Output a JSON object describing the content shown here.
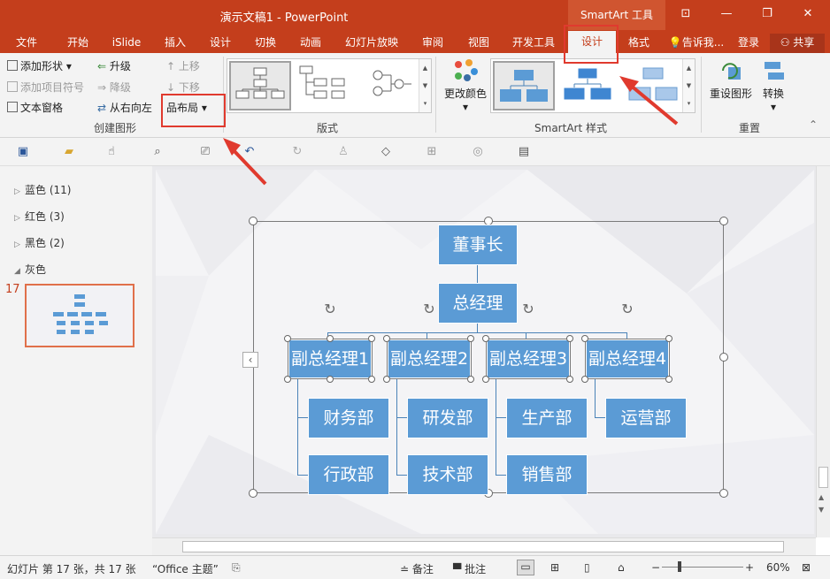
{
  "window": {
    "title": "演示文稿1 - PowerPoint",
    "context_tab": "SmartArt 工具",
    "buttons": [
      "ribbon-display",
      "minimize",
      "restore",
      "close"
    ]
  },
  "tabs": [
    "文件",
    "开始",
    "iSlide",
    "插入",
    "设计",
    "切换",
    "动画",
    "幻灯片放映",
    "审阅",
    "视图",
    "开发工具",
    "设计",
    "格式"
  ],
  "active_tab_index": 11,
  "tellme": "告诉我...",
  "account": {
    "login": "登录",
    "share": "共享"
  },
  "ribbon": {
    "create_graphic": {
      "label": "创建图形",
      "add_shape": "添加形状",
      "add_bullet": "添加项目符号",
      "text_pane": "文本窗格",
      "promote": "升级",
      "demote": "降级",
      "right_to_left": "从右向左",
      "move_up": "上移",
      "move_down": "下移",
      "layout": "布局"
    },
    "layouts": {
      "label": "版式"
    },
    "smartart_styles": {
      "label": "SmartArt 样式",
      "change_colors": "更改颜色"
    },
    "reset": {
      "label": "重置",
      "reset_graphic": "重设图形",
      "convert": "转换"
    }
  },
  "sidebar": {
    "sections": [
      {
        "name": "蓝色",
        "count": "(11)",
        "collapsed": true
      },
      {
        "name": "红色",
        "count": "(3)",
        "collapsed": true
      },
      {
        "name": "黑色",
        "count": "(2)",
        "collapsed": true
      },
      {
        "name": "灰色",
        "count": "",
        "collapsed": false
      }
    ],
    "slide_number": "17"
  },
  "org_chart": {
    "chairman": "董事长",
    "gm": "总经理",
    "deputies": [
      "副总经理1",
      "副总经理2",
      "副总经理3",
      "副总经理4"
    ],
    "row1": [
      "财务部",
      "研发部",
      "生产部",
      "运营部"
    ],
    "row2": [
      "行政部",
      "技术部",
      "销售部"
    ]
  },
  "status": {
    "slide_info": "幻灯片 第 17 张，共 17 张",
    "theme": "“Office 主题”",
    "notes": "备注",
    "comments": "批注",
    "zoom": "60%"
  },
  "colors": {
    "accent": "#c43e1c",
    "node": "#5b9bd5",
    "annotation": "#e03a2e"
  }
}
